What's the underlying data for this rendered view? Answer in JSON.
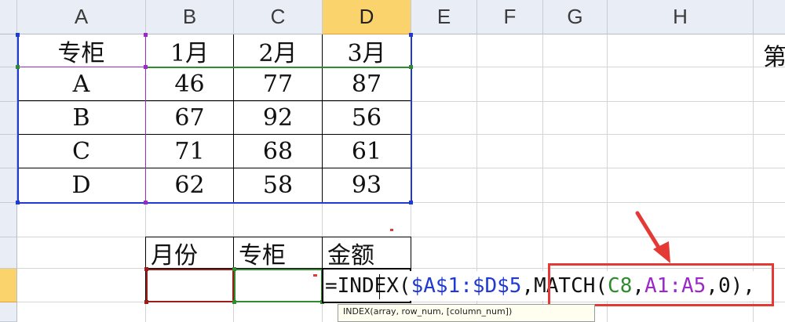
{
  "columns": [
    "A",
    "B",
    "C",
    "D",
    "E",
    "F",
    "G",
    "H"
  ],
  "table": {
    "header": [
      "专柜",
      "1月",
      "2月",
      "3月"
    ],
    "rows": [
      [
        "A",
        "46",
        "77",
        "87"
      ],
      [
        "B",
        "67",
        "92",
        "56"
      ],
      [
        "C",
        "71",
        "68",
        "61"
      ],
      [
        "D",
        "62",
        "58",
        "93"
      ]
    ]
  },
  "lookup": {
    "headers": [
      "月份",
      "专柜",
      "金额"
    ]
  },
  "formula": {
    "prefix": "=INDEX(",
    "ref1": "$A$1:$D$5",
    "sep1": ",",
    "match_name": "MATCH(",
    "arg1": "C8",
    "comma": ",",
    "arg2": "A1:A5",
    "arg3_part": ",0)",
    "tail": ","
  },
  "tooltip": {
    "line1": "INDEX(array, row_num, [column_num])"
  },
  "partial_text": "第",
  "colors": {
    "selected_header": "#fbd36c",
    "ref_blue": "#1f3ad3",
    "ref_green": "#2e8b2e",
    "ref_purple": "#9b28c8",
    "ref_darkred": "#9c1c1c",
    "highlight_box": "#e53935"
  }
}
